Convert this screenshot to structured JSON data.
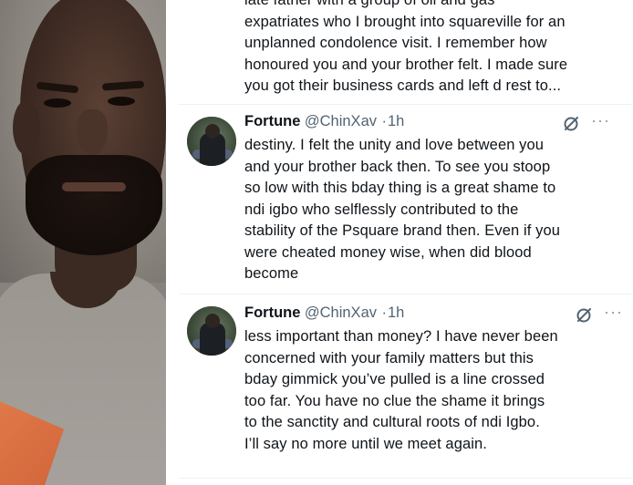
{
  "tweet_continued": {
    "lines": [
      "late father with a group of oil and gas",
      "expatriates who I brought into squareville for an",
      "unplanned condolence visit. I remember how",
      "honoured you and your brother felt. I made sure",
      "you got their business cards and left d rest to..."
    ]
  },
  "tweets": [
    {
      "author_name": "Fortune",
      "handle": "@ChinXav",
      "separator": "·",
      "time": "1h",
      "lines": [
        "destiny. I felt the unity and love between you",
        "and your brother back then. To see you stoop",
        "so low with this bday thing is a great shame to",
        "ndi igbo who selflessly contributed to the",
        "stability of the Psquare brand then. Even if you",
        "were cheated money wise, when did blood",
        "become"
      ]
    },
    {
      "author_name": "Fortune",
      "handle": "@ChinXav",
      "separator": "·",
      "time": "1h",
      "lines": [
        "less important than money? I have never been",
        "concerned with your family matters but this",
        "bday gimmick you’ve pulled is a line crossed",
        "too far. You have no clue the shame it brings",
        "to the sanctity and cultural roots of ndi Igbo.",
        "I’ll say no more until we meet again."
      ]
    }
  ],
  "icons": {
    "grok": "grok-icon",
    "more": "more-options-icon",
    "avatar": "avatar"
  },
  "colors": {
    "text": "#0f1419",
    "secondary": "#536471",
    "divider": "#eff3f4"
  }
}
